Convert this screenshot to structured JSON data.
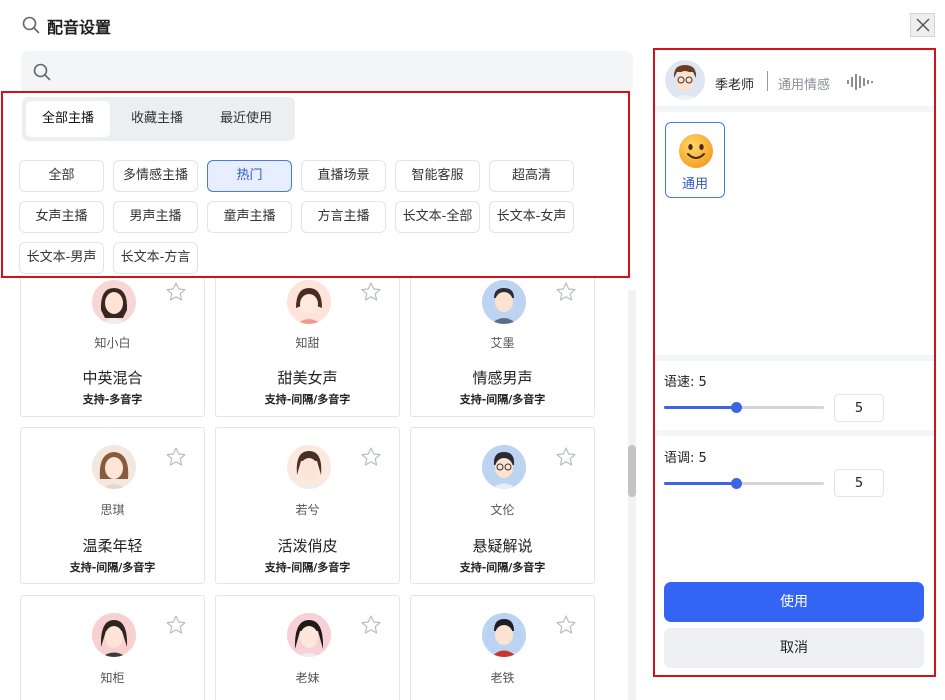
{
  "dialog": {
    "title": "配音设置",
    "title_icon": "search-icon",
    "close_icon": "close-icon"
  },
  "search": {
    "placeholder": "",
    "value": "",
    "icon": "search-icon"
  },
  "tabs": [
    {
      "label": "全部主播",
      "active": true
    },
    {
      "label": "收藏主播",
      "active": false
    },
    {
      "label": "最近使用",
      "active": false
    }
  ],
  "categories": [
    {
      "label": "全部"
    },
    {
      "label": "多情感主播"
    },
    {
      "label": "热门",
      "active": true
    },
    {
      "label": "直播场景"
    },
    {
      "label": "智能客服"
    },
    {
      "label": "超高清"
    },
    {
      "label": "女声主播"
    },
    {
      "label": "男声主播"
    },
    {
      "label": "童声主播"
    },
    {
      "label": "方言主播"
    },
    {
      "label": "长文本-全部"
    },
    {
      "label": "长文本-女声"
    },
    {
      "label": "长文本-男声"
    },
    {
      "label": "长文本-方言"
    }
  ],
  "voices": [
    {
      "name": "知小白",
      "style": "中英混合",
      "support": "支持-多音字"
    },
    {
      "name": "知甜",
      "style": "甜美女声",
      "support": "支持-间隔/多音字"
    },
    {
      "name": "艾墨",
      "style": "情感男声",
      "support": "支持-间隔/多音字"
    },
    {
      "name": "思琪",
      "style": "温柔年轻",
      "support": "支持-间隔/多音字"
    },
    {
      "name": "若兮",
      "style": "活泼俏皮",
      "support": "支持-间隔/多音字"
    },
    {
      "name": "文伦",
      "style": "悬疑解说",
      "support": "支持-间隔/多音字"
    },
    {
      "name": "知柜",
      "style": "",
      "support": ""
    },
    {
      "name": "老妹",
      "style": "",
      "support": ""
    },
    {
      "name": "老铁",
      "style": "",
      "support": ""
    }
  ],
  "selected": {
    "name": "季老师",
    "emotion": "通用情感",
    "emotion_options": [
      {
        "label": "通用",
        "icon": "smiley-icon"
      }
    ],
    "speed": {
      "label": "语速:",
      "value": "5",
      "input": "5",
      "level": 0.45
    },
    "pitch": {
      "label": "语调:",
      "value": "5",
      "input": "5",
      "level": 0.45
    }
  },
  "buttons": {
    "use": "使用",
    "cancel": "取消"
  },
  "colors": {
    "accent": "#3464f4",
    "highlight": "#d0131b",
    "chip_active_bg": "#e6eeff"
  }
}
